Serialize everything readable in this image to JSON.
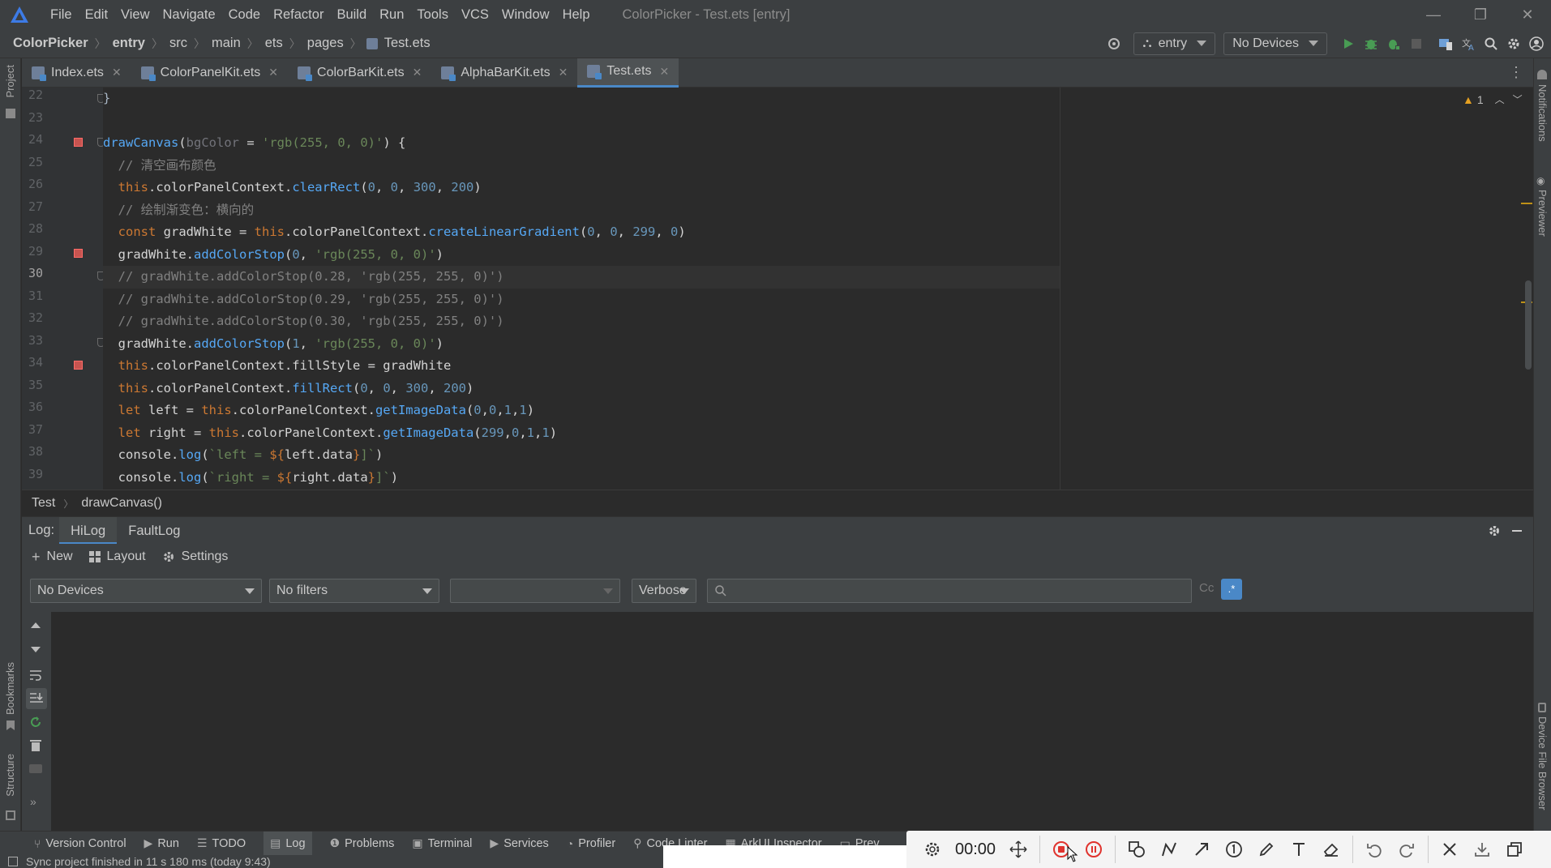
{
  "menubar": {
    "items": [
      "File",
      "Edit",
      "View",
      "Navigate",
      "Code",
      "Refactor",
      "Build",
      "Run",
      "Tools",
      "VCS",
      "Window",
      "Help"
    ],
    "title": "ColorPicker - Test.ets [entry]"
  },
  "navbar": {
    "crumbs": [
      "ColorPicker",
      "entry",
      "src",
      "main",
      "ets",
      "pages",
      "Test.ets"
    ],
    "run_config": "entry",
    "device": "No Devices"
  },
  "tabs": [
    {
      "label": "Index.ets"
    },
    {
      "label": "ColorPanelKit.ets"
    },
    {
      "label": "ColorBarKit.ets"
    },
    {
      "label": "AlphaBarKit.ets"
    },
    {
      "label": "Test.ets"
    }
  ],
  "editor": {
    "warning_count": "1",
    "line_numbers": [
      "22",
      "23",
      "24",
      "25",
      "26",
      "27",
      "28",
      "29",
      "30",
      "31",
      "32",
      "33",
      "34",
      "35",
      "36",
      "37",
      "38",
      "39"
    ],
    "current_line": "30"
  },
  "editor_breadcrumb": {
    "a": "Test",
    "b": "drawCanvas()"
  },
  "log": {
    "label": "Log:",
    "tabs": [
      "HiLog",
      "FaultLog"
    ],
    "toolbar": {
      "new": "New",
      "layout": "Layout",
      "settings": "Settings"
    },
    "device_select": "No Devices",
    "filter_select": "No filters",
    "process_select": "",
    "level_select": "Verbose",
    "search_value": "",
    "case_toggle": "Cc",
    "regex_toggle": ".*"
  },
  "side_strips": {
    "left_top": "Project",
    "left_bookmarks": "Bookmarks",
    "left_structure": "Structure",
    "right_notifications": "Notifications",
    "right_previewer": "Previewer",
    "right_device_file_browser": "Device File Browser"
  },
  "bottom_tools": [
    "Version Control",
    "Run",
    "TODO",
    "Log",
    "Problems",
    "Terminal",
    "Services",
    "Profiler",
    "Code Linter",
    "ArkUI Inspector",
    "Prev"
  ],
  "status": {
    "message": "Sync project finished in 11 s 180 ms (today 9:43)"
  },
  "recorder": {
    "time": "00:00"
  }
}
